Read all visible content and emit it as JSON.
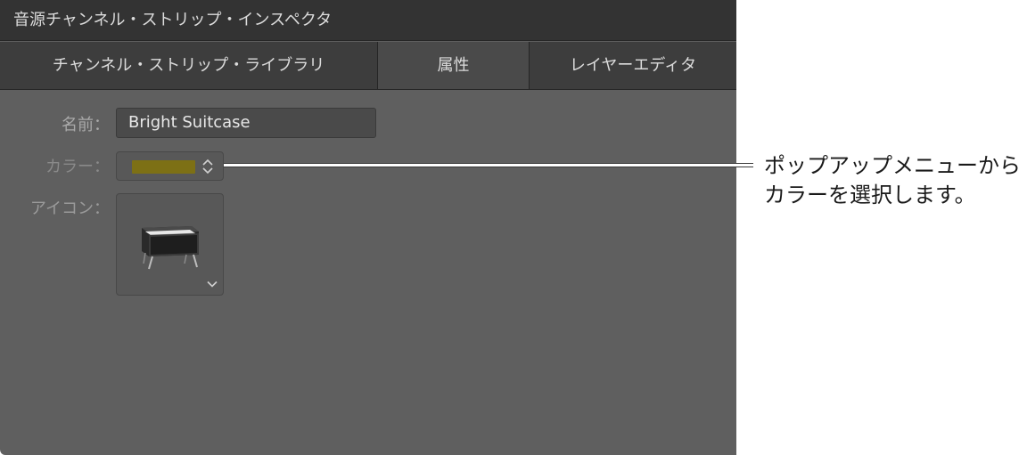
{
  "inspector": {
    "title": "音源チャンネル・ストリップ・インスペクタ",
    "tabs": [
      {
        "label": "チャンネル・ストリップ・ライブラリ"
      },
      {
        "label": "属性"
      },
      {
        "label": "レイヤーエディタ"
      }
    ],
    "selected_tab": "属性",
    "fields": {
      "name_label": "名前：",
      "name_value": "Bright Suitcase",
      "color_label": "カラー：",
      "color_value": "#7d7015",
      "icon_label": "アイコン：",
      "icon_name": "electric-piano-icon"
    }
  },
  "callout": {
    "line1": "ポップアップメニューから",
    "line2": "カラーを選択します。"
  },
  "colors": {
    "panel_bg": "#5f5f5f",
    "titlebar_bg": "#333333",
    "tabbar_bg": "#3d3d3d",
    "selected_tab_bg": "#4a4a4a"
  }
}
